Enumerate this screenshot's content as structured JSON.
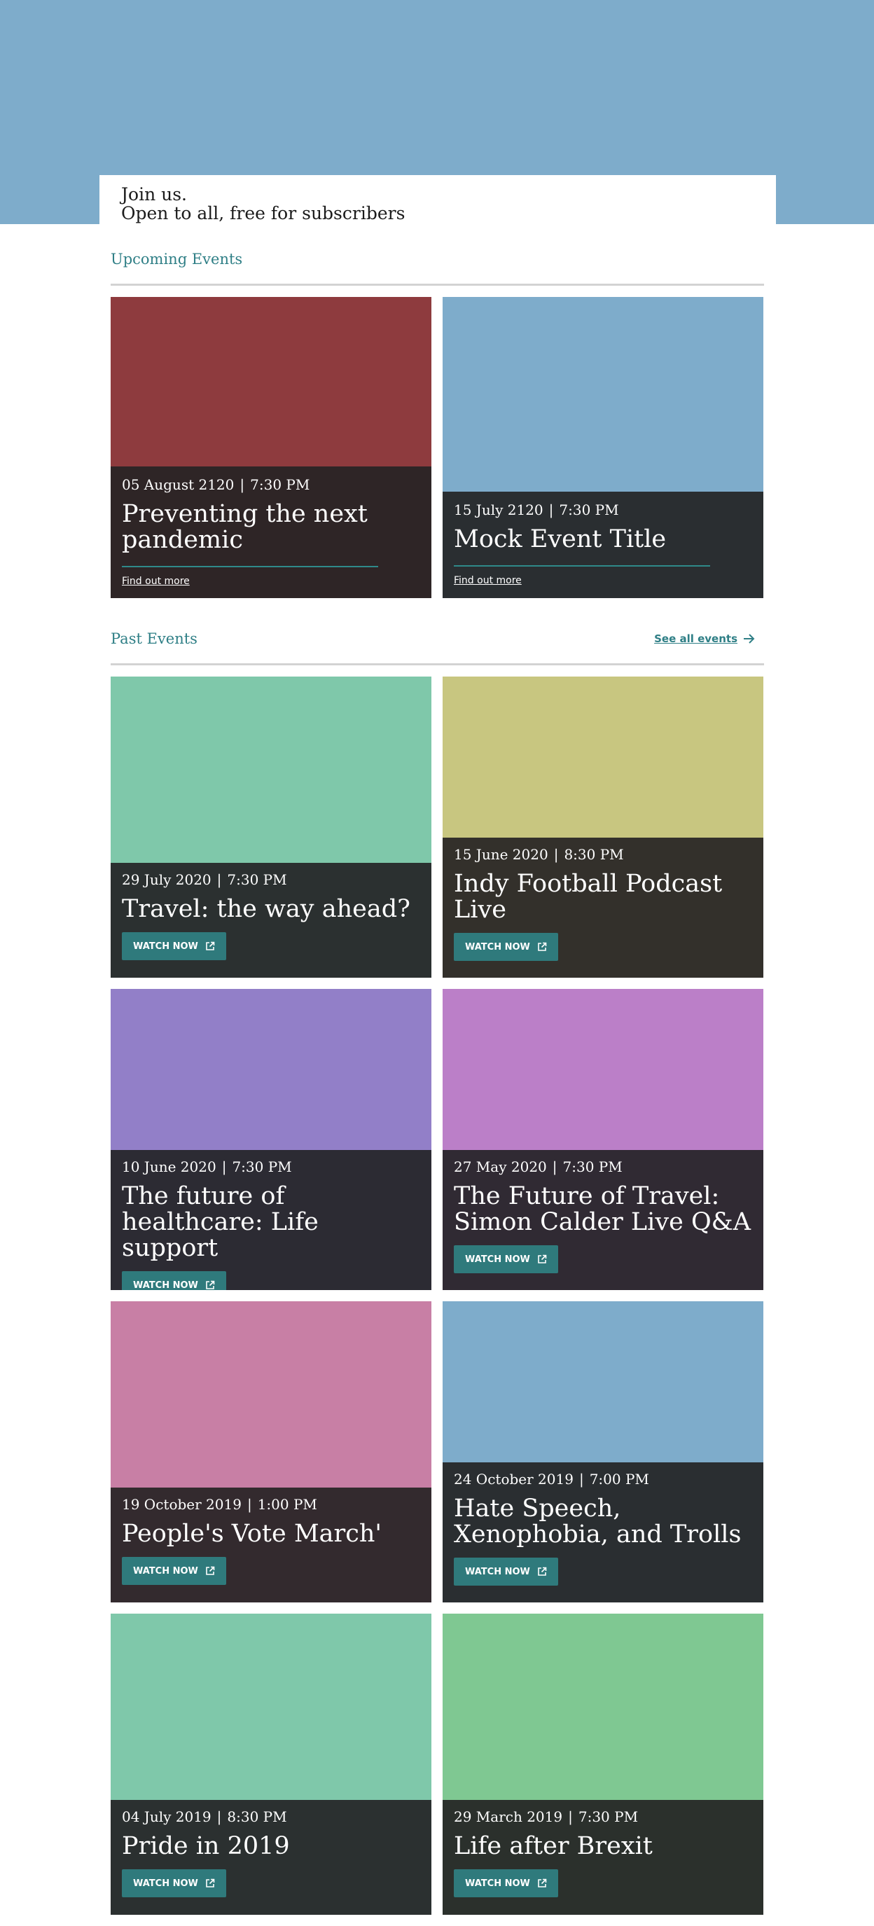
{
  "hero": {
    "color": "#7eaccb",
    "line1": "Join us.",
    "line2": "Open to all, free for subscribers"
  },
  "upcoming": {
    "title": "Upcoming Events",
    "events": [
      {
        "date": "05 August 2120",
        "time": "7:30 PM",
        "title": "Preventing the next pandemic",
        "link_label": "Find out more",
        "image_color": "#8e3b3e",
        "panel_color": "#2e2526"
      },
      {
        "date": "15 July 2120",
        "time": "7:30 PM",
        "title": "Mock Event Title",
        "link_label": "Find out more",
        "image_color": "#7eaccb",
        "panel_color": "#2a2e31"
      }
    ]
  },
  "past": {
    "title": "Past Events",
    "see_all_label": "See all events",
    "button_label": "WATCH NOW",
    "events": [
      {
        "date": "29 July 2020",
        "time": "7:30 PM",
        "title": "Travel: the way ahead?",
        "image_color": "#7fc8aa",
        "panel_color": "#2b3030"
      },
      {
        "date": "15 June 2020",
        "time": "8:30 PM",
        "title": "Indy Football Podcast Live",
        "image_color": "#c8c680",
        "panel_color": "#33302b"
      },
      {
        "date": "10 June 2020",
        "time": "7:30 PM",
        "title": "The future of healthcare: Life support",
        "image_color": "#927fc8",
        "panel_color": "#2c2b33"
      },
      {
        "date": "27 May 2020",
        "time": "7:30 PM",
        "title": "The Future of Travel: Simon Calder Live Q&A",
        "image_color": "#bb7fc8",
        "panel_color": "#302a33"
      },
      {
        "date": "19 October 2019",
        "time": "1:00 PM",
        "title": "People's Vote March'",
        "image_color": "#c87fa5",
        "panel_color": "#332a2e"
      },
      {
        "date": "24 October 2019",
        "time": "7:00 PM",
        "title": "Hate Speech, Xenophobia, and Trolls",
        "image_color": "#7eaccb",
        "panel_color": "#2a2e31"
      },
      {
        "date": "04 July 2019",
        "time": "8:30 PM",
        "title": "Pride in 2019",
        "image_color": "#7fc8aa",
        "panel_color": "#2b3030"
      },
      {
        "date": "29 March 2019",
        "time": "7:30 PM",
        "title": "Life after Brexit",
        "image_color": "#7fc892",
        "panel_color": "#2b302c"
      }
    ]
  },
  "colors": {
    "accent": "#2f7f86",
    "button": "#2f7a7c",
    "divider": "#d3d3d3"
  },
  "icons": {
    "see_all": "arrow-right-icon",
    "watch": "external-link-icon"
  }
}
